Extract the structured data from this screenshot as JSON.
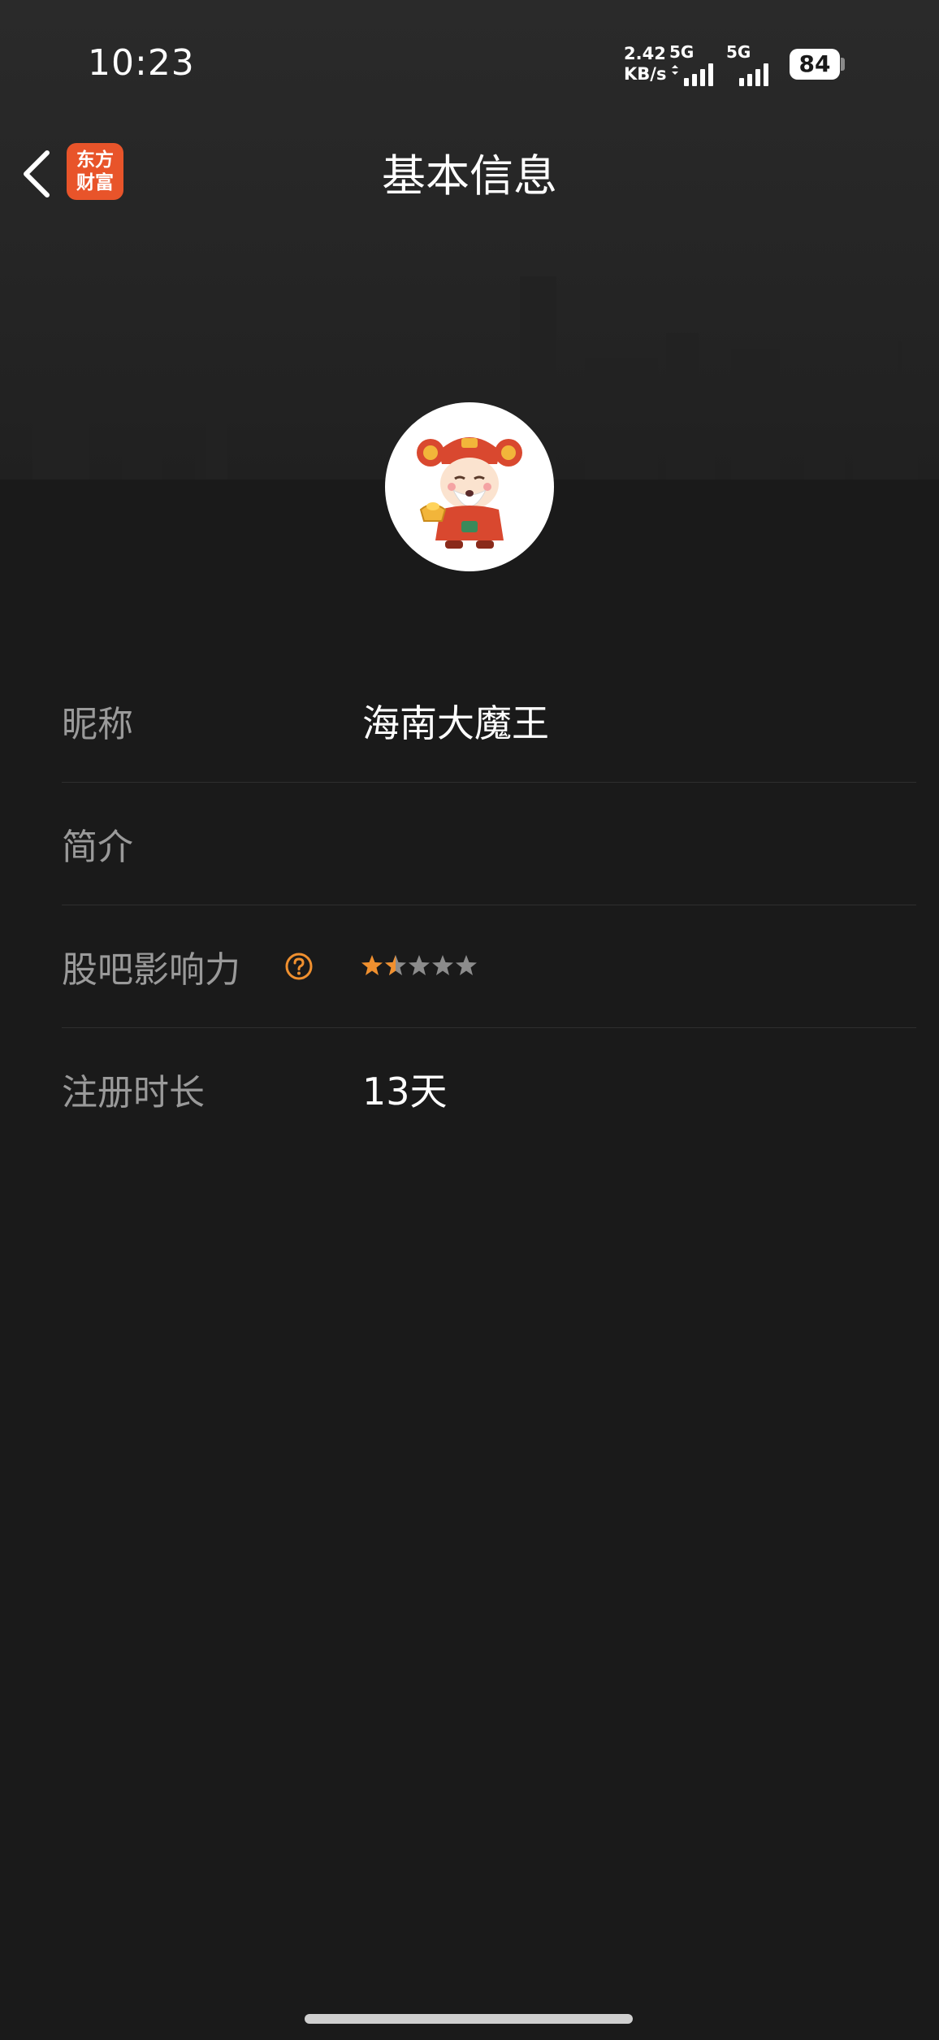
{
  "status_bar": {
    "time": "10:23",
    "net_speed_value": "2.42",
    "net_speed_unit": "KB/s",
    "sim1_tag": "5G",
    "sim2_tag": "5G",
    "battery": "84"
  },
  "nav": {
    "title": "基本信息",
    "app_badge_line1": "东方",
    "app_badge_line2": "财富"
  },
  "profile": {
    "rows": [
      {
        "label": "昵称",
        "value": "海南大魔王"
      },
      {
        "label": "简介",
        "value": ""
      },
      {
        "label": "股吧影响力",
        "rating": 1.5,
        "rating_max": 5
      },
      {
        "label": "注册时长",
        "value": "13天"
      }
    ]
  },
  "colors": {
    "background": "#1a1a1a",
    "accent": "#e8542a",
    "star_active": "#f0902f",
    "star_inactive": "#8c8c8c",
    "label": "#9a9a9a"
  }
}
